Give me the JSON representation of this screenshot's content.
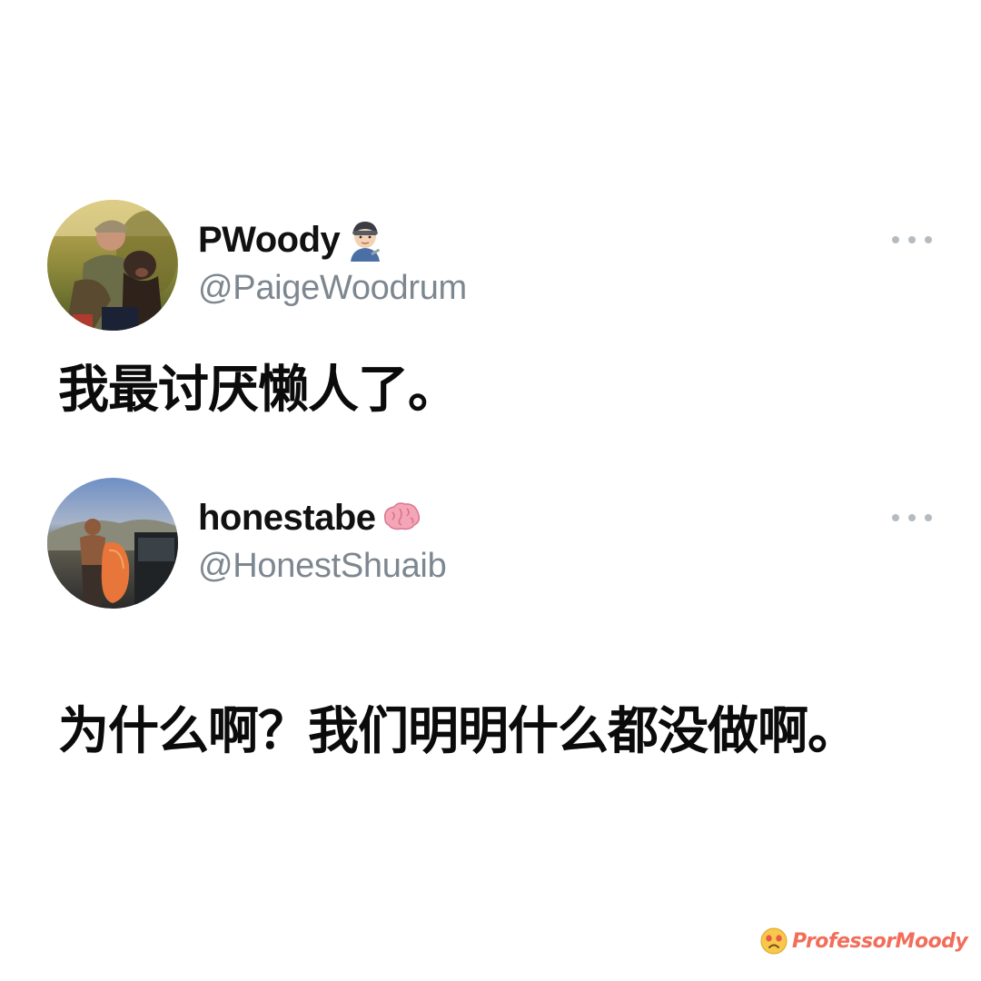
{
  "tweets": [
    {
      "display_name": "PWoody",
      "name_emoji": "woman-mechanic-emoji",
      "handle": "@PaigeWoodrum",
      "text": "我最讨厌懒人了。",
      "more_icon": "more-horizontal-icon"
    },
    {
      "display_name": "honestabe",
      "name_emoji": "brain-emoji",
      "handle": "@HonestShuaib",
      "text": "为什么啊？我们明明什么都没做啊。",
      "more_icon": "more-horizontal-icon"
    }
  ],
  "watermark": {
    "icon": "sad-face-emoji",
    "text": "ProfessorMoody"
  },
  "colors": {
    "handle": "#7d8790",
    "more_dots": "#b4bbc1",
    "text": "#0b0b0b",
    "watermark": "#f26d5a"
  }
}
